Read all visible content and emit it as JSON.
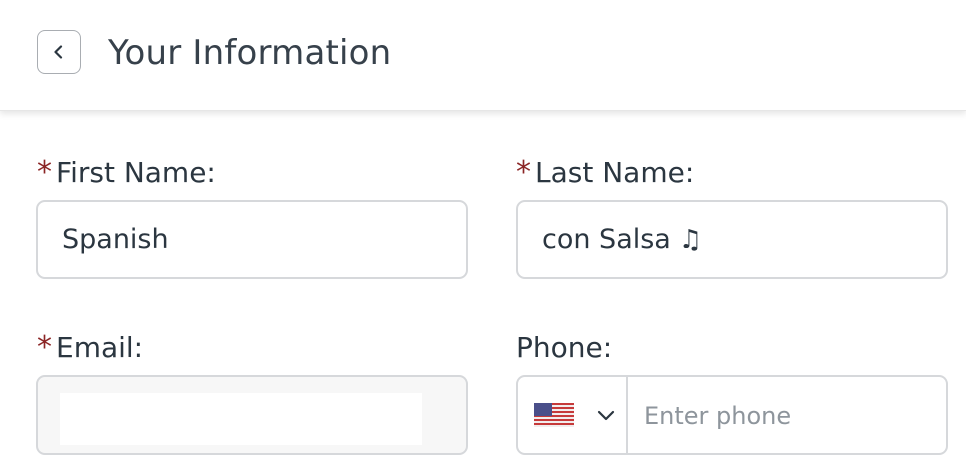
{
  "header": {
    "title": "Your Information",
    "back_icon": "chevron-left-icon"
  },
  "form": {
    "first_name": {
      "required_mark": "*",
      "label": "First Name:",
      "value": "Spanish"
    },
    "last_name": {
      "required_mark": "*",
      "label": "Last Name:",
      "value": "con Salsa",
      "suffix_glyph": "♫"
    },
    "email": {
      "required_mark": "*",
      "label": "Email:",
      "value": ""
    },
    "phone": {
      "label": "Phone:",
      "country_flag": "us-flag-icon",
      "placeholder": "Enter phone",
      "value": ""
    }
  },
  "colors": {
    "required": "#8b2525",
    "border": "#d6d8db",
    "text": "#2b3640"
  }
}
